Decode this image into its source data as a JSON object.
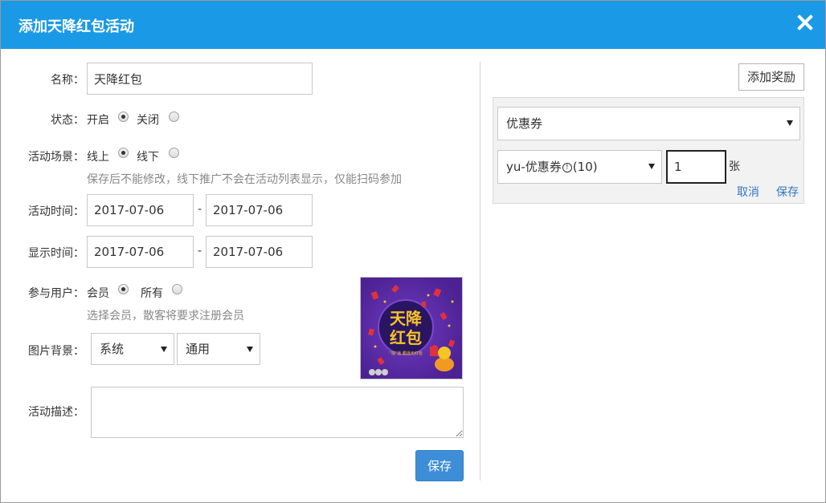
{
  "dialog": {
    "title": "添加天降红包活动"
  },
  "form": {
    "name": {
      "label": "名称：",
      "value": "天降红包"
    },
    "status": {
      "label": "状态：",
      "options": [
        "开启",
        "关闭"
      ],
      "selected": 0
    },
    "scene": {
      "label": "活动场景：",
      "options": [
        "线上",
        "线下"
      ],
      "selected": 0,
      "hint": "保存后不能修改，线下推广不会在活动列表显示，仅能扫码参加"
    },
    "activity_time": {
      "label": "活动时间：",
      "start": "2017-07-06",
      "end": "2017-07-06",
      "separator": "-"
    },
    "display_time": {
      "label": "显示时间：",
      "start": "2017-07-06",
      "end": "2017-07-06",
      "separator": "-"
    },
    "participants": {
      "label": "参与用户：",
      "options": [
        "会员",
        "所有"
      ],
      "selected": 0,
      "hint": "选择会员，散客将要求注册会员"
    },
    "background": {
      "label": "图片背景：",
      "type_value": "系统",
      "style_value": "通用"
    },
    "description": {
      "label": "活动描述：",
      "value": ""
    },
    "save_label": "保存"
  },
  "poster": {
    "line1": "天降",
    "line2": "红包",
    "tagline": "“钱”途 霸道无红包",
    "colors": {
      "bg": "#5a2aa8",
      "circle": "#2a1560",
      "text": "#f7c425"
    }
  },
  "reward": {
    "add_label": "添加奖励",
    "type_value": "优惠券",
    "coupon_value": "yu-优惠券",
    "coupon_info_icon": "info-circle-icon",
    "coupon_count": "(10)",
    "quantity_value": "1",
    "unit": "张",
    "cancel_label": "取消",
    "save_label": "保存"
  }
}
